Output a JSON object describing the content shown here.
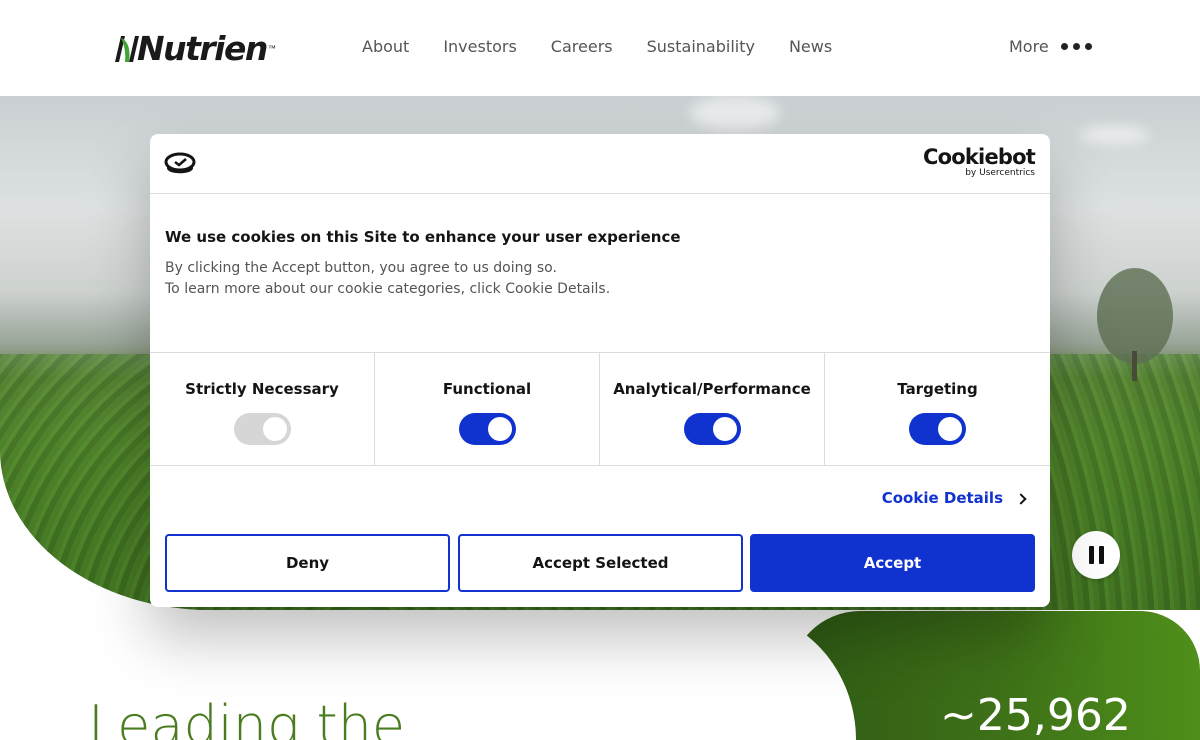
{
  "header": {
    "logo_text": "Nutrien",
    "logo_tm": "™",
    "nav": [
      "About",
      "Investors",
      "Careers",
      "Sustainability",
      "News"
    ],
    "more_label": "More"
  },
  "hero": {
    "pause_icon": "pause-icon"
  },
  "page": {
    "headline": "Leading the",
    "stat": "~25,962"
  },
  "cookie_dialog": {
    "brand_name": "Cookiebot",
    "brand_sub": "by Usercentrics",
    "title": "We use cookies on this Site to enhance your user experience",
    "text_line1": "By clicking the Accept button, you agree to us doing so.",
    "text_line2": "To learn more about our cookie categories, click Cookie Details.",
    "categories": [
      {
        "label": "Strictly Necessary",
        "enabled": true,
        "locked": true
      },
      {
        "label": "Functional",
        "enabled": true,
        "locked": false
      },
      {
        "label": "Analytical/Performance",
        "enabled": true,
        "locked": false
      },
      {
        "label": "Targeting",
        "enabled": true,
        "locked": false
      }
    ],
    "details_link": "Cookie Details",
    "buttons": {
      "deny": "Deny",
      "accept_selected": "Accept Selected",
      "accept": "Accept"
    }
  },
  "colors": {
    "accent": "#1032cf",
    "brand_green": "#4a7d22",
    "toggle_disabled": "#d6d6d6"
  }
}
